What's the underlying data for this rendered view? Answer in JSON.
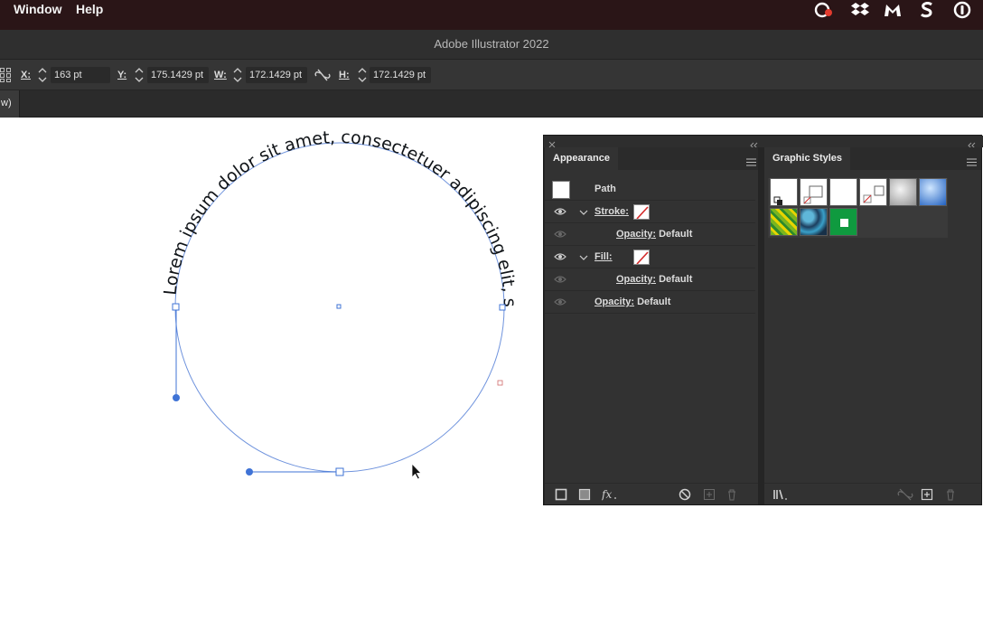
{
  "menubar": {
    "items": [
      "Window",
      "Help"
    ],
    "tray_icons": [
      "creative-cloud-icon",
      "dropbox-icon",
      "malwarebytes-icon",
      "scrivener-icon",
      "onepassword-icon"
    ]
  },
  "app": {
    "title": "Adobe Illustrator 2022"
  },
  "control_bar": {
    "x_label": "X:",
    "x_value": "163 pt",
    "y_label": "Y:",
    "y_value": "175.1429 pt",
    "w_label": "W:",
    "w_value": "172.1429 pt",
    "h_label": "H:",
    "h_value": "172.1429 pt"
  },
  "tabs": {
    "active_tab_fragment": "w)"
  },
  "artwork": {
    "path_text": "Lorem ipsum dolor sit amet, consectetuer adipiscing elit, sed diam",
    "path_color": "#4a7bd8"
  },
  "appearance": {
    "tab_label": "Appearance",
    "object_label": "Path",
    "stroke_label": "Stroke:",
    "fill_label": "Fill:",
    "opacity_label": "Opacity:",
    "opacity_value": "Default"
  },
  "graphic_styles": {
    "tab_label": "Graphic Styles"
  },
  "colors": {
    "menubar_bg": "#2a1517",
    "panel_bg": "#323232",
    "selection_blue": "#3f73d6",
    "gs_green": "#0f9a3f"
  }
}
